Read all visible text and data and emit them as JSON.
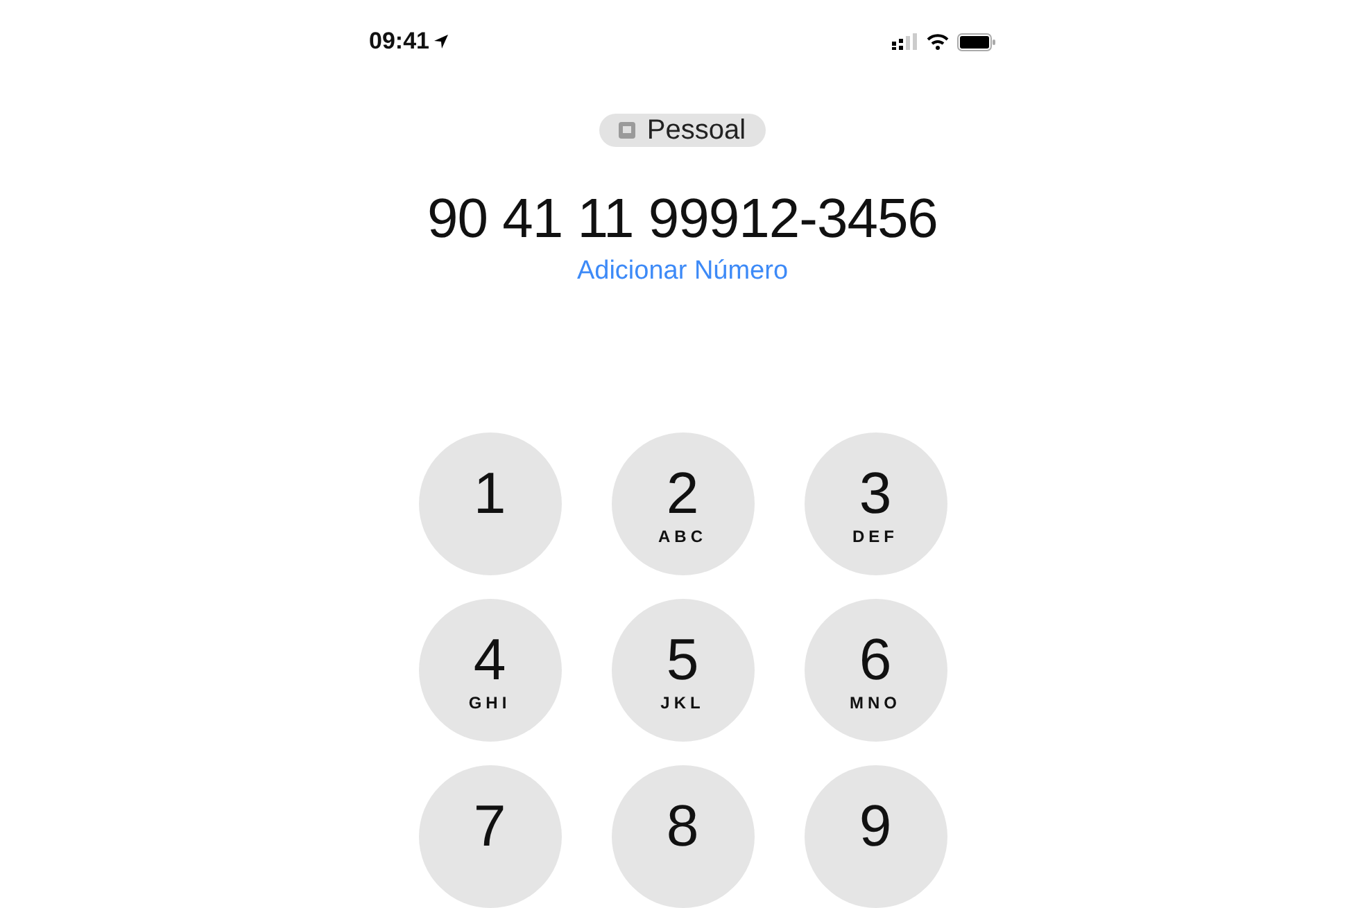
{
  "status_bar": {
    "time": "09:41"
  },
  "line_chip": {
    "label": "Pessoal"
  },
  "dialed_number": "90 41 11 99912-3456",
  "add_number_link": "Adicionar Número",
  "keypad": [
    {
      "digit": "1"
    },
    {
      "digit": "2",
      "letters": "ABC"
    },
    {
      "digit": "3",
      "letters": "DEF"
    },
    {
      "digit": "4",
      "letters": "GHI"
    },
    {
      "digit": "5",
      "letters": "JKL"
    },
    {
      "digit": "6",
      "letters": "MNO"
    },
    {
      "digit": "7"
    },
    {
      "digit": "8"
    },
    {
      "digit": "9"
    }
  ]
}
